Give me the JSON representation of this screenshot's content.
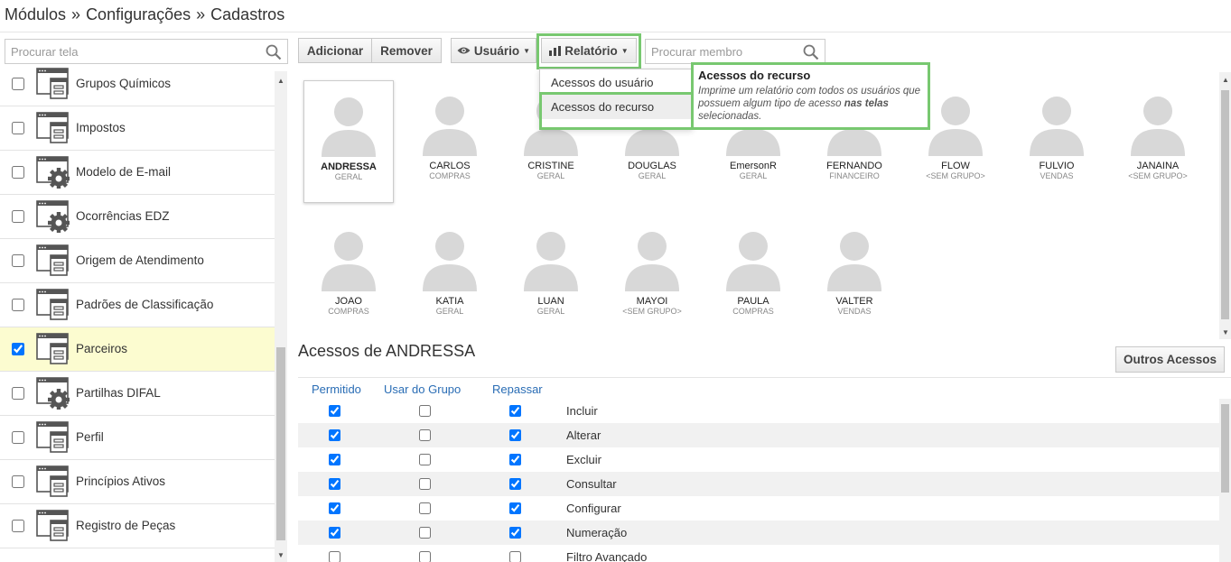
{
  "breadcrumb": [
    "Módulos",
    "Configurações",
    "Cadastros"
  ],
  "breadcrumb_sep": "»",
  "left_search": {
    "placeholder": "Procurar tela"
  },
  "left_items": [
    {
      "label": "Grupos Químicos",
      "checked": false,
      "icon": "form-icon"
    },
    {
      "label": "Impostos",
      "checked": false,
      "icon": "form-icon"
    },
    {
      "label": "Modelo de E-mail",
      "checked": false,
      "icon": "gear-form-icon"
    },
    {
      "label": "Ocorrências EDZ",
      "checked": false,
      "icon": "gear-form-icon"
    },
    {
      "label": "Origem de Atendimento",
      "checked": false,
      "icon": "form-icon"
    },
    {
      "label": "Padrões de Classificação",
      "checked": false,
      "icon": "form-icon"
    },
    {
      "label": "Parceiros",
      "checked": true,
      "icon": "form-icon"
    },
    {
      "label": "Partilhas DIFAL",
      "checked": false,
      "icon": "gear-form-icon"
    },
    {
      "label": "Perfil",
      "checked": false,
      "icon": "form-icon"
    },
    {
      "label": "Princípios Ativos",
      "checked": false,
      "icon": "form-icon"
    },
    {
      "label": "Registro de Peças",
      "checked": false,
      "icon": "form-icon"
    }
  ],
  "toolbar": {
    "add_label": "Adicionar",
    "remove_label": "Remover",
    "user_label": "Usuário",
    "report_label": "Relatório",
    "member_search_placeholder": "Procurar membro"
  },
  "report_menu": {
    "items": [
      "Acessos do usuário",
      "Acessos do recurso"
    ],
    "hovered_index": 1
  },
  "tooltip": {
    "title": "Acessos do recurso",
    "body_start": "Imprime um relatório com todos os usuários que possuem algum tipo de acesso ",
    "body_bold": "nas telas",
    "body_end": " selecionadas."
  },
  "members": [
    {
      "name": "ANDRESSA",
      "group": "GERAL",
      "selected": true
    },
    {
      "name": "CARLOS",
      "group": "COMPRAS"
    },
    {
      "name": "CRISTINE",
      "group": "GERAL"
    },
    {
      "name": "DOUGLAS",
      "group": "GERAL"
    },
    {
      "name": "EmersonR",
      "group": "GERAL"
    },
    {
      "name": "FERNANDO",
      "group": "FINANCEIRO"
    },
    {
      "name": "FLOW",
      "group": "<SEM GRUPO>"
    },
    {
      "name": "FULVIO",
      "group": "VENDAS"
    },
    {
      "name": "JANAINA",
      "group": "<SEM GRUPO>"
    },
    {
      "name": "JOAO",
      "group": "COMPRAS"
    },
    {
      "name": "KATIA",
      "group": "GERAL"
    },
    {
      "name": "LUAN",
      "group": "GERAL"
    },
    {
      "name": "MAYOI",
      "group": "<SEM GRUPO>"
    },
    {
      "name": "PAULA",
      "group": "COMPRAS"
    },
    {
      "name": "VALTER",
      "group": "VENDAS"
    }
  ],
  "access": {
    "title": "Acessos de ANDRESSA",
    "other_button": "Outros Acessos",
    "columns": [
      "Permitido",
      "Usar do Grupo",
      "Repassar"
    ],
    "rows": [
      {
        "label": "Incluir",
        "permitido": true,
        "grupo": false,
        "repassar": true
      },
      {
        "label": "Alterar",
        "permitido": true,
        "grupo": false,
        "repassar": true
      },
      {
        "label": "Excluir",
        "permitido": true,
        "grupo": false,
        "repassar": true
      },
      {
        "label": "Consultar",
        "permitido": true,
        "grupo": false,
        "repassar": true
      },
      {
        "label": "Configurar",
        "permitido": true,
        "grupo": false,
        "repassar": true
      },
      {
        "label": "Numeração",
        "permitido": true,
        "grupo": false,
        "repassar": true
      },
      {
        "label": "Filtro Avançado",
        "permitido": false,
        "grupo": false,
        "repassar": false
      }
    ]
  },
  "colors": {
    "highlight": "#78c870",
    "selected_row": "#fcfcd0",
    "link": "#2a6db5"
  }
}
